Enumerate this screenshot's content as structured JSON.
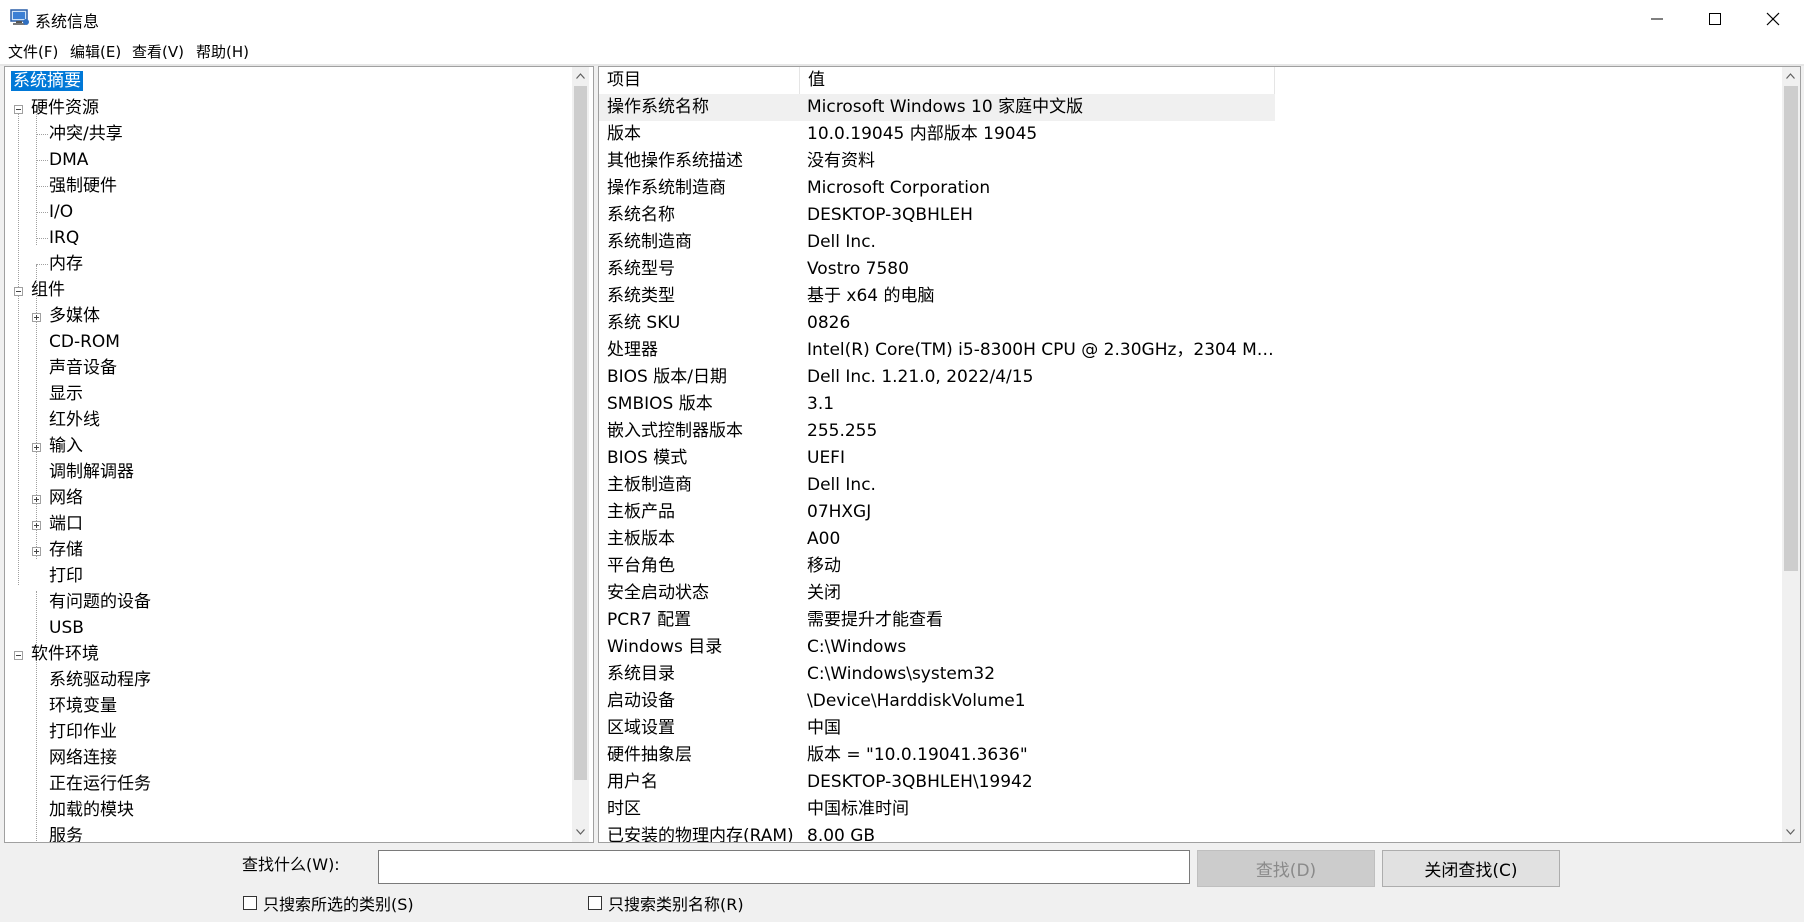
{
  "window": {
    "title": "系统信息"
  },
  "menu": [
    "文件(F)",
    "编辑(E)",
    "查看(V)",
    "帮助(H)"
  ],
  "tree": {
    "root": "系统摘要",
    "hardware": {
      "label": "硬件资源",
      "children": [
        "冲突/共享",
        "DMA",
        "强制硬件",
        "I/O",
        "IRQ",
        "内存"
      ]
    },
    "components": {
      "label": "组件",
      "children": [
        "多媒体",
        "CD-ROM",
        "声音设备",
        "显示",
        "红外线",
        "输入",
        "调制解调器",
        "网络",
        "端口",
        "存储",
        "打印",
        "有问题的设备",
        "USB"
      ]
    },
    "software": {
      "label": "软件环境",
      "children": [
        "系统驱动程序",
        "环境变量",
        "打印作业",
        "网络连接",
        "正在运行任务",
        "加载的模块",
        "服务"
      ]
    }
  },
  "list": {
    "headers": [
      "项目",
      "值"
    ],
    "rows": [
      [
        "操作系统名称",
        "Microsoft Windows 10 家庭中文版"
      ],
      [
        "版本",
        "10.0.19045 内部版本 19045"
      ],
      [
        "其他操作系统描述",
        "没有资料"
      ],
      [
        "操作系统制造商",
        "Microsoft Corporation"
      ],
      [
        "系统名称",
        "DESKTOP-3QBHLEH"
      ],
      [
        "系统制造商",
        "Dell Inc."
      ],
      [
        "系统型号",
        "Vostro 7580"
      ],
      [
        "系统类型",
        "基于 x64 的电脑"
      ],
      [
        "系统 SKU",
        "0826"
      ],
      [
        "处理器",
        "Intel(R) Core(TM) i5-8300H CPU @ 2.30GHz，2304 Mh..."
      ],
      [
        "BIOS 版本/日期",
        "Dell Inc. 1.21.0, 2022/4/15"
      ],
      [
        "SMBIOS 版本",
        "3.1"
      ],
      [
        "嵌入式控制器版本",
        "255.255"
      ],
      [
        "BIOS 模式",
        "UEFI"
      ],
      [
        "主板制造商",
        "Dell Inc."
      ],
      [
        "主板产品",
        "07HXGJ"
      ],
      [
        "主板版本",
        "A00"
      ],
      [
        "平台角色",
        "移动"
      ],
      [
        "安全启动状态",
        "关闭"
      ],
      [
        "PCR7 配置",
        "需要提升才能查看"
      ],
      [
        "Windows 目录",
        "C:\\Windows"
      ],
      [
        "系统目录",
        "C:\\Windows\\system32"
      ],
      [
        "启动设备",
        "\\Device\\HarddiskVolume1"
      ],
      [
        "区域设置",
        "中国"
      ],
      [
        "硬件抽象层",
        "版本 = \"10.0.19041.3636\""
      ],
      [
        "用户名",
        "DESKTOP-3QBHLEH\\19942"
      ],
      [
        "时区",
        "中国标准时间"
      ],
      [
        "已安装的物理内存(RAM)",
        "8.00 GB"
      ]
    ]
  },
  "find": {
    "label": "查找什么(W):",
    "value": "",
    "find_button": "查找(D)",
    "close_button": "关闭查找(C)",
    "check_selected": "只搜索所选的类别(S)",
    "check_names": "只搜索类别名称(R)"
  },
  "colors": {
    "selection": "#0078d7",
    "window_bg": "#f0f0f0"
  },
  "icons": [
    "system-info-icon",
    "minimize-icon",
    "maximize-icon",
    "close-icon"
  ]
}
